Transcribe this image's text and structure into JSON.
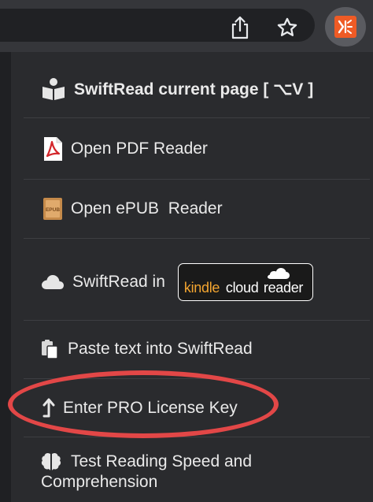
{
  "colors": {
    "toolbar_bg": "#35363a",
    "menu_bg": "#2a2b2e",
    "text": "#eaeaea",
    "extension_accent": "#ef5b25",
    "highlight_ring": "#e24747",
    "kindle_orange": "#f3a530"
  },
  "toolbar": {
    "share_icon": "share-icon",
    "star_icon": "bookmark-star-icon",
    "extension_icon": "swiftread-extension-icon"
  },
  "menu": {
    "items": [
      {
        "icon": "book-reader-icon",
        "label": "SwiftRead current page [ ⌥V ]"
      },
      {
        "icon": "pdf-file-icon",
        "label": "Open PDF Reader"
      },
      {
        "icon": "epub-file-icon",
        "label": "Open ePUB  Reader"
      },
      {
        "icon": "cloud-icon",
        "label": "SwiftRead in"
      },
      {
        "icon": "paste-icon",
        "label": "Paste text into SwiftRead"
      },
      {
        "icon": "upload-arrow-icon",
        "label": "Enter PRO License Key"
      },
      {
        "icon": "brain-icon",
        "label": "Test Reading Speed and",
        "label2": "Comprehension"
      }
    ],
    "kindle_badge": {
      "word1": "kindle",
      "word2": "cloud",
      "word3": "reader"
    },
    "epub_label": "EPUB"
  }
}
